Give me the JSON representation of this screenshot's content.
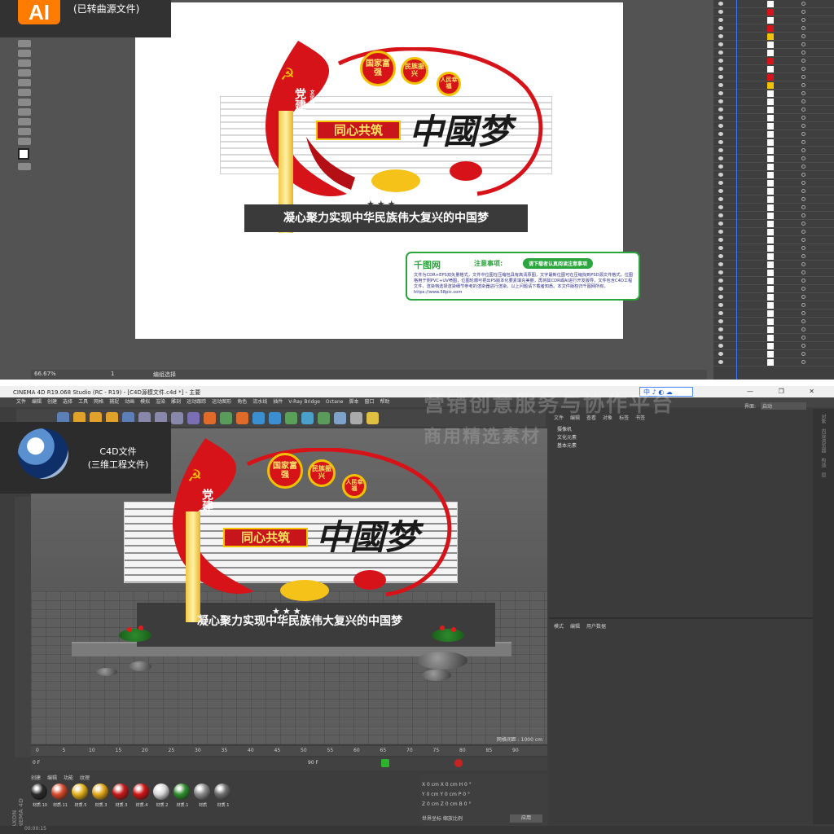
{
  "ai_panel": {
    "app_logo": "AI",
    "note": "(已转曲源文件)",
    "zoom": "66.67%",
    "page_nav": "1",
    "status_label": "编组选择"
  },
  "sign": {
    "party_label": "党建",
    "party_sub": "文化墙",
    "circle1": "国家富强",
    "circle2": "民族振兴",
    "circle3": "人民幸福",
    "plaque": "同心共筑",
    "dream": "中國梦",
    "stars": "★★★",
    "banner": "凝心聚力实现中华民族伟大复兴的中国梦"
  },
  "notice": {
    "logo": "千图网",
    "title": "注意事项:",
    "pill": "请下载者认真阅读注意事项",
    "body": "文件为CDR+EPS双矢量格式，文件中位图在压缩包具有高清原图，文字最新位图可在压缩找到PSD源文件格式，位图格用于侧PVC+UV喷图，位图轮廓可把出PS版本化要素填充美丽，再将其CDR或AI进行开发版导，文件包含C4D工程文件，渲染档选择渲染细节参考的渲染器进行渲染。以上问题请下载者知悉。本文件版权归千图网所有，https://www.58pic.com"
  },
  "c4d_panel": {
    "title": "CINEMA 4D R19.068 Studio (RC - R19) - [C4D源模文件.c4d *] - 主要",
    "win_buttons": "—  ❐  ✕",
    "lang_box": "中 ♪ ◐ ☁",
    "menu": [
      "文件",
      "编辑",
      "创建",
      "选择",
      "工具",
      "网格",
      "捕捉",
      "动画",
      "模拟",
      "渲染",
      "雕刻",
      "运动跟踪",
      "运动图形",
      "角色",
      "流水线",
      "插件",
      "V-Ray Bridge",
      "Octane",
      "脚本",
      "窗口",
      "帮助"
    ],
    "note_line1": "C4D文件",
    "note_line2": "(三维工程文件)",
    "viewport_info": "网格间距 : 1000 cm",
    "timeline_ticks": [
      "0",
      "5",
      "10",
      "15",
      "20",
      "25",
      "30",
      "35",
      "40",
      "45",
      "50",
      "55",
      "60",
      "65",
      "70",
      "75",
      "80",
      "85",
      "90"
    ],
    "frame_start": "0 F",
    "frame_end": "90 F",
    "frame_current": "0 F",
    "materials_menu": [
      "创建",
      "编辑",
      "功能",
      "纹理"
    ],
    "materials": [
      {
        "label": "材质.10",
        "color": "#2a2a2a"
      },
      {
        "label": "材质.11",
        "color": "#d84a2c"
      },
      {
        "label": "材质.5",
        "color": "#e3b21b"
      },
      {
        "label": "材质.3",
        "color": "#e3a81a"
      },
      {
        "label": "材质.3",
        "color": "#c81a1a"
      },
      {
        "label": "材质.4",
        "color": "#d11616"
      },
      {
        "label": "材质.2",
        "color": "#d8d8d8"
      },
      {
        "label": "材质.1",
        "color": "#2f8f2f"
      },
      {
        "label": "材质",
        "color": "#8a8a8a"
      },
      {
        "label": "材质.1",
        "color": "#6e6e6e"
      }
    ],
    "coords": [
      "X  0 cm    X  0 cm    H  0 °",
      "Y  0 cm    Y  0 cm    P  0 °",
      "Z  0 cm    Z  0 cm    B  0 °"
    ],
    "coord_mode": "世界坐标     缩放比例",
    "apply": "应用",
    "obj_tabs": [
      "文件",
      "编辑",
      "查看",
      "对象",
      "标签",
      "书签"
    ],
    "objects": [
      "摄像机",
      "文化元素",
      "基本元素"
    ],
    "attr_tabs": [
      "模式",
      "编辑",
      "用户数据"
    ],
    "interface_label": "界面:",
    "interface_value": "启动",
    "right_strip": [
      "对象",
      "内容浏览器",
      "构造",
      "层"
    ],
    "time": "00:00:15",
    "maxon": "MAXON CINEMA 4D",
    "watermark1": "营销创意服务与协作平台",
    "watermark2": "商用精选素材"
  },
  "colors": {
    "ai_orange": "#ff7c00",
    "party_red": "#d7131a",
    "gold": "#f2c200",
    "notice_green": "#2aa63c"
  }
}
